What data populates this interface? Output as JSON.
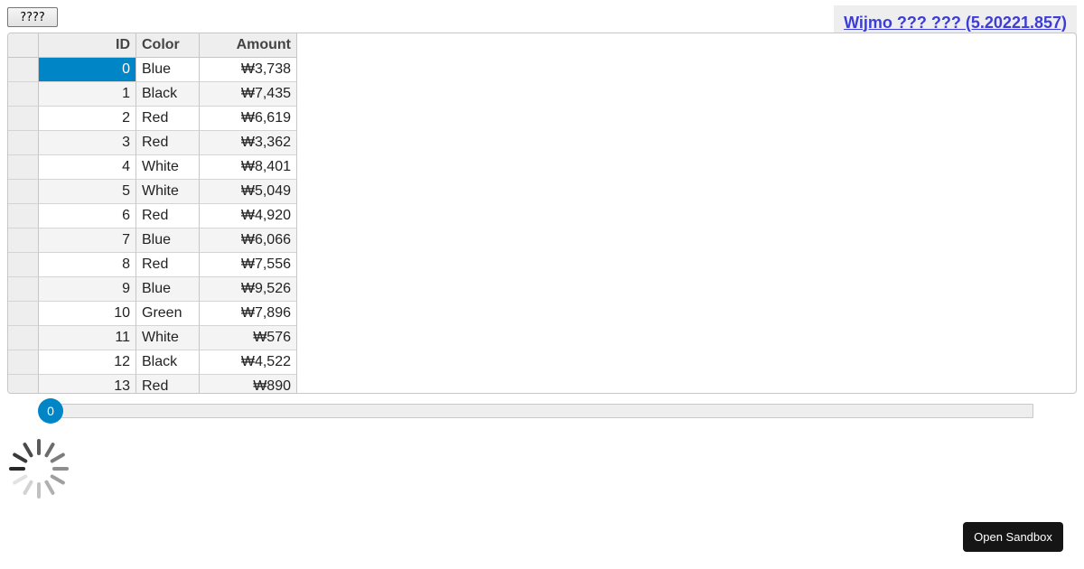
{
  "toolbar": {
    "button_label": "????",
    "button_icon": "placeholder-glyph-icon"
  },
  "banner": {
    "link_text": "Wijmo ??? ??? (5.20221.857)",
    "color": "#3c3cd8"
  },
  "grid": {
    "columns": [
      "ID",
      "Color",
      "Amount"
    ],
    "selected_row": 0,
    "selection_color": "#0085c7",
    "rows": [
      {
        "id": "0",
        "color": "Blue",
        "amount": "₩3,738"
      },
      {
        "id": "1",
        "color": "Black",
        "amount": "₩7,435"
      },
      {
        "id": "2",
        "color": "Red",
        "amount": "₩6,619"
      },
      {
        "id": "3",
        "color": "Red",
        "amount": "₩3,362"
      },
      {
        "id": "4",
        "color": "White",
        "amount": "₩8,401"
      },
      {
        "id": "5",
        "color": "White",
        "amount": "₩5,049"
      },
      {
        "id": "6",
        "color": "Red",
        "amount": "₩4,920"
      },
      {
        "id": "7",
        "color": "Blue",
        "amount": "₩6,066"
      },
      {
        "id": "8",
        "color": "Red",
        "amount": "₩7,556"
      },
      {
        "id": "9",
        "color": "Blue",
        "amount": "₩9,526"
      },
      {
        "id": "10",
        "color": "Green",
        "amount": "₩7,896"
      },
      {
        "id": "11",
        "color": "White",
        "amount": "₩576"
      },
      {
        "id": "12",
        "color": "Black",
        "amount": "₩4,522"
      },
      {
        "id": "13",
        "color": "Red",
        "amount": "₩890"
      }
    ]
  },
  "slider": {
    "value": "0",
    "color": "#0085c7"
  },
  "spinner": {
    "icon": "loading-spinner-icon"
  },
  "sandbox": {
    "label": "Open Sandbox"
  }
}
